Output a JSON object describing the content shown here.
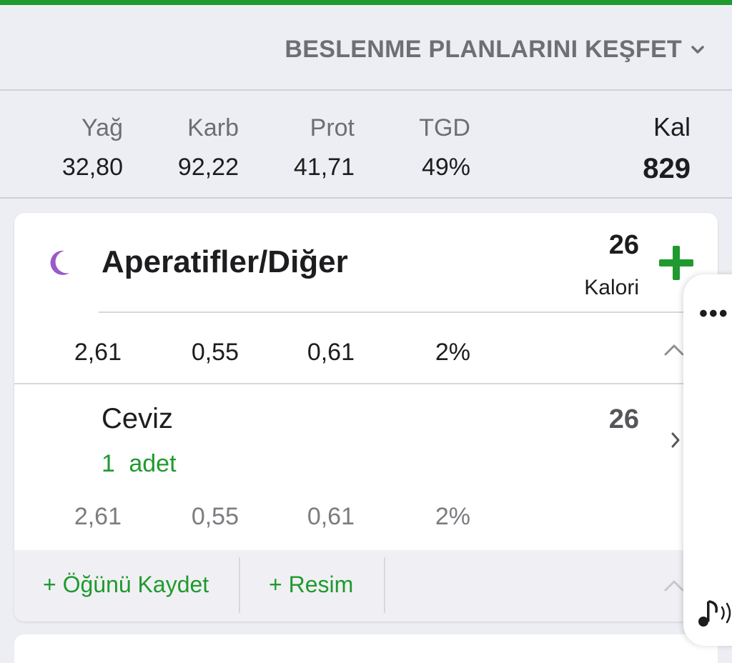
{
  "header": {
    "explore_label": "BESLENME PLANLARINI KEŞFET"
  },
  "summary": {
    "labels": {
      "fat": "Yağ",
      "carb": "Karb",
      "prot": "Prot",
      "tgd": "TGD",
      "kal": "Kal"
    },
    "values": {
      "fat": "32,80",
      "carb": "92,22",
      "prot": "41,71",
      "tgd": "49%",
      "kal": "829"
    }
  },
  "meal": {
    "title": "Aperatifler/Diğer",
    "calories": "26",
    "calories_label": "Kalori",
    "macros": {
      "fat": "2,61",
      "carb": "0,55",
      "prot": "0,61",
      "tgd": "2%"
    },
    "items": [
      {
        "name": "Ceviz",
        "quantity": "1 adet",
        "calories": "26",
        "macros": {
          "fat": "2,61",
          "carb": "0,55",
          "prot": "0,61",
          "tgd": "2%"
        }
      }
    ],
    "footer": {
      "save_meal": "+ Öğünü Kaydet",
      "add_photo": "+ Resim"
    }
  },
  "side_panel": {
    "more_label": "•••"
  },
  "colors": {
    "accent": "#1f9a2e",
    "moon": "#9b59c9",
    "background": "#edeef3"
  },
  "icons": [
    "chevron-down-icon",
    "moon-icon",
    "plus-icon",
    "chevron-up-icon",
    "chevron-right-icon",
    "more-icon",
    "music-icon"
  ]
}
